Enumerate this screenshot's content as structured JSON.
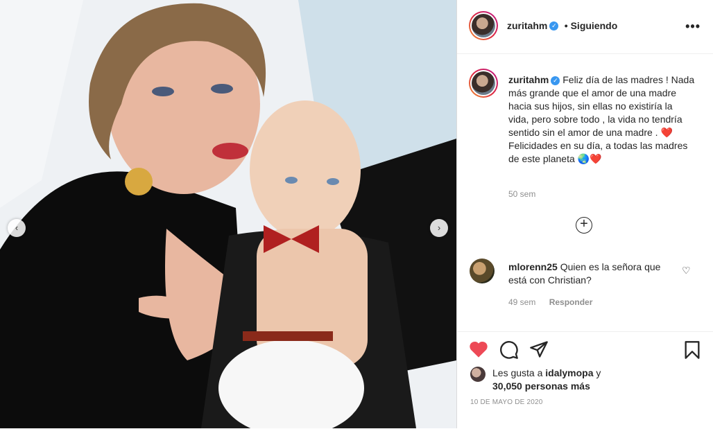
{
  "post": {
    "username": "zuritahm",
    "follow_status": "• Siguiendo",
    "more_icon": "•••",
    "verified_mark": "✓"
  },
  "caption": {
    "username": "zuritahm",
    "text": "Feliz día de las madres ! Nada más grande que el amor de una madre hacia sus hijos, sin ellas no existiría la vida, pero sobre todo , la vida no tendría sentido sin el amor de una madre . ❤️\nFelicidades en su día, a todas las madres de este planeta 🌏❤️",
    "time": "50 sem"
  },
  "add_comment_icon": "+",
  "comments": [
    {
      "username": "mlorenn25",
      "text": "Quien es la señora que está con Christian?",
      "time": "49 sem",
      "reply_label": "Responder",
      "like_icon": "♡"
    }
  ],
  "likes": {
    "prefix": "Les gusta a ",
    "user": "idalymopa",
    "joiner": " y",
    "count_text": "30,050 personas más"
  },
  "date": "10 DE MAYO DE 2020",
  "nav": {
    "prev": "‹",
    "next": "›"
  },
  "colors": {
    "like_red": "#ed4956",
    "verified_blue": "#3897f0"
  }
}
